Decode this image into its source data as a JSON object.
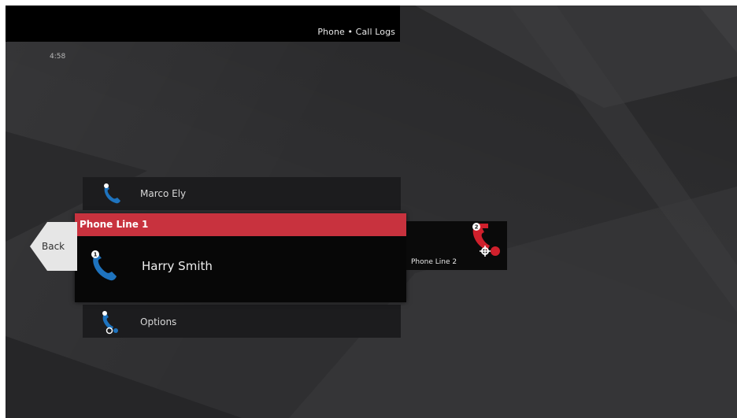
{
  "header": {
    "title": "Phone • Call Logs"
  },
  "clock": "4:58",
  "list": {
    "previous": {
      "label": "Marco Ely",
      "icon": "blue-phone-handset-icon"
    },
    "selected": {
      "line": "Phone Line 1",
      "name": "Harry Smith",
      "badge": "1",
      "icon": "blue-phone-handset-icon"
    },
    "next": {
      "label": "Options",
      "icon": "phone-settings-icon"
    }
  },
  "back": {
    "label": "Back"
  },
  "secondary": {
    "label": "Phone Line 2",
    "badge": "2",
    "icon": "red-phone-settings-icon"
  },
  "colors": {
    "accent_red": "#c8323e",
    "phone_blue": "#1e73be",
    "phone_red": "#d0202c",
    "background": "#2f2f31"
  }
}
